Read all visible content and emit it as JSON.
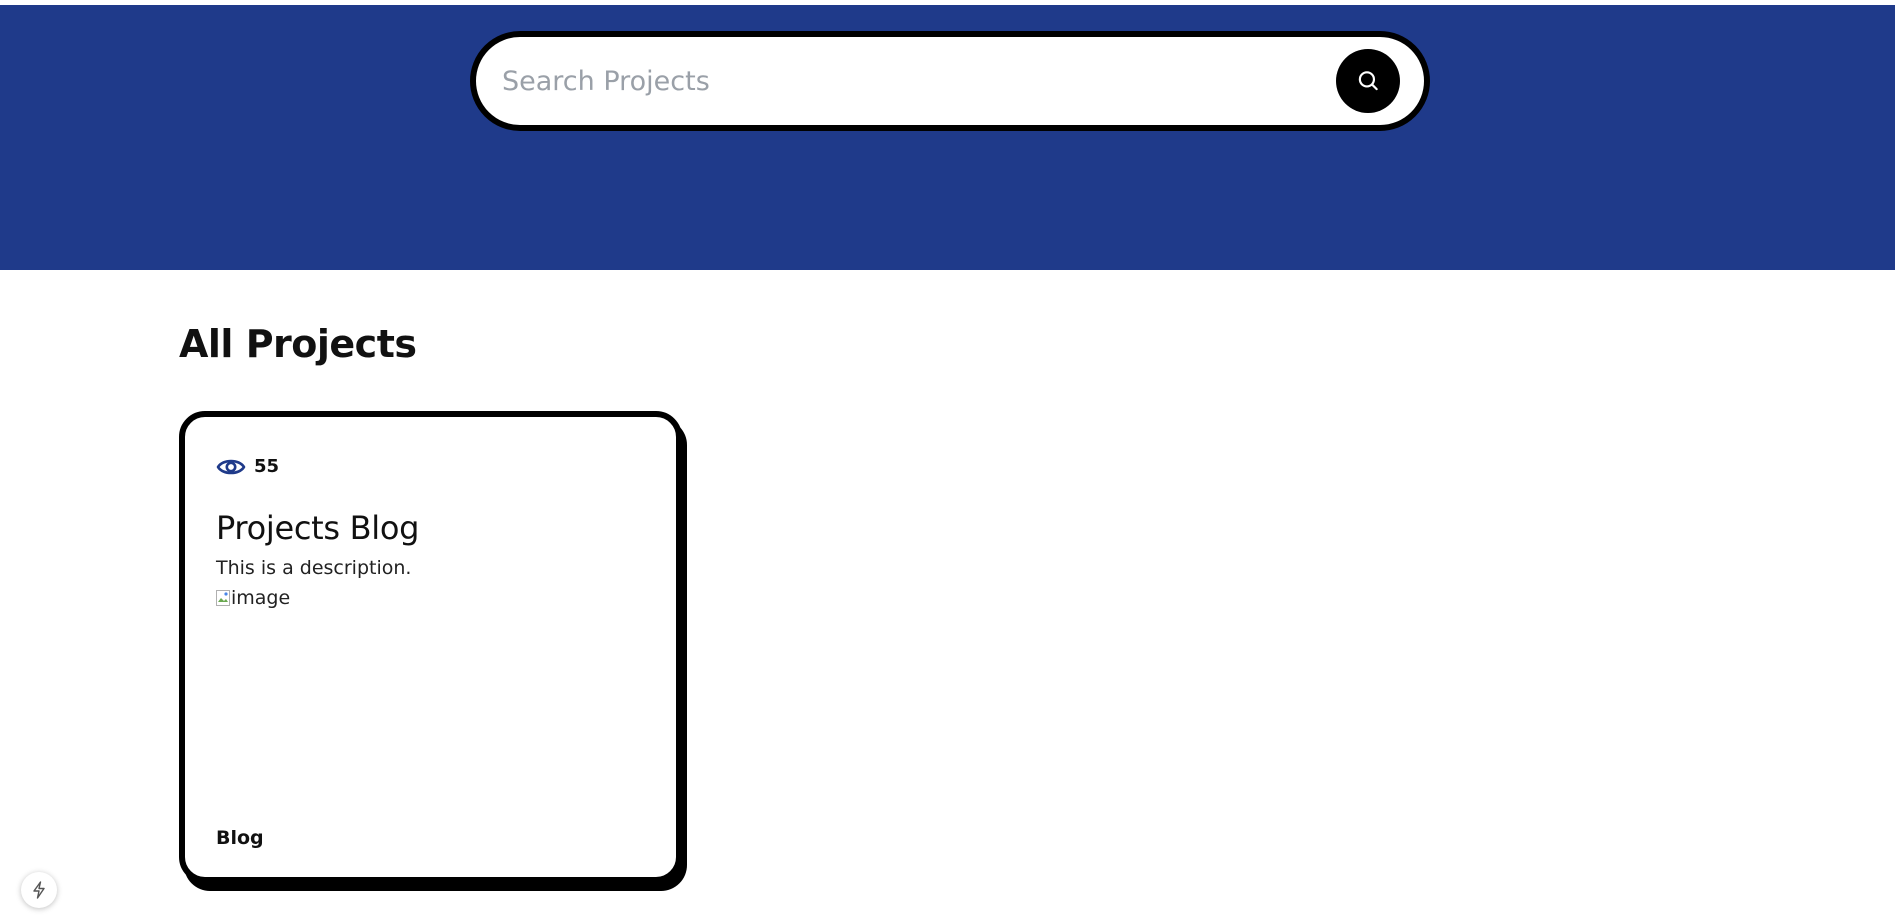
{
  "search": {
    "placeholder": "Search Projects",
    "value": "",
    "button_icon": "search-icon"
  },
  "main": {
    "title": "All Projects"
  },
  "projects": [
    {
      "views": "55",
      "views_icon": "eye-icon",
      "title": "Projects Blog",
      "description": "This is a description.",
      "image_alt": "image",
      "tag": "Blog"
    }
  ],
  "dev_indicator": {
    "icon": "lightning-bolt-icon"
  },
  "colors": {
    "hero_background": "#1f3a8a",
    "card_border": "#000000",
    "eye_icon": "#1f3a8a",
    "placeholder": "#9aa0a8"
  }
}
